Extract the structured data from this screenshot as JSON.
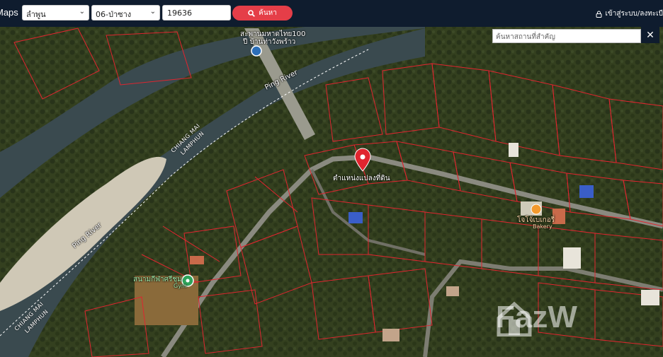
{
  "header": {
    "brand": "Maps",
    "province_select": "ลำพูน",
    "district_select": "06-ป่าซาง",
    "parcel_number": "19636",
    "search_button": "ค้นหา",
    "login_link": "เข้าสู่ระบบ/ลงทะเบี"
  },
  "map": {
    "poi_search_placeholder": "ค้นหาสถานที่สำคัญ",
    "close_label": "✕",
    "labels": {
      "bridge": "สะพานมหาดไทย100",
      "bridge_sub": "ปี บ้านท่าวังพร้าว",
      "river_top": "Ping River",
      "river_left": "Ping River",
      "boundary_top_1": "CHIANG MAI",
      "boundary_top_2": "LAMPHUN",
      "boundary_bottom_1": "CHIANG MAI",
      "boundary_bottom_2": "LAMPHUN",
      "parcel_marker": "ตำแหน่งแปลงที่ดิน",
      "stadium": "สนามกีฬาศรีชุม",
      "stadium_sub": "Gym",
      "bakery": "โจโจ้เบเกอรี่",
      "bakery_sub": "Bakery",
      "watermark": "FazW"
    },
    "colors": {
      "parcel_lines": "#e0252f",
      "marker": "#e0252f",
      "river": "#3b4a4e",
      "vegetation": "#2f3a24"
    }
  }
}
